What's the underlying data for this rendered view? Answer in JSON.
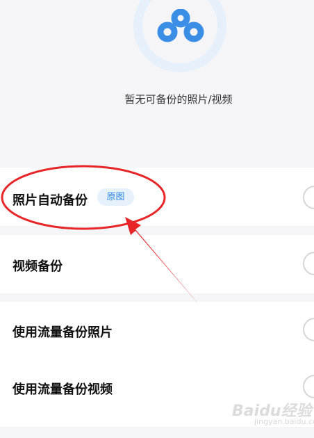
{
  "empty_state": {
    "message": "暂无可备份的照片/视频",
    "icon": "cloud-logo-icon"
  },
  "settings": [
    {
      "label": "照片自动备份",
      "badge": "原图"
    },
    {
      "label": "视频备份"
    },
    {
      "label": "使用流量备份照片"
    },
    {
      "label": "使用流量备份视频"
    }
  ],
  "watermark": {
    "text": "Baidu经验",
    "sub": "jingyan.baidu.com"
  },
  "colors": {
    "accent": "#2f86e0",
    "annotation": "#e8262a",
    "logo": "#3a8ee6"
  }
}
